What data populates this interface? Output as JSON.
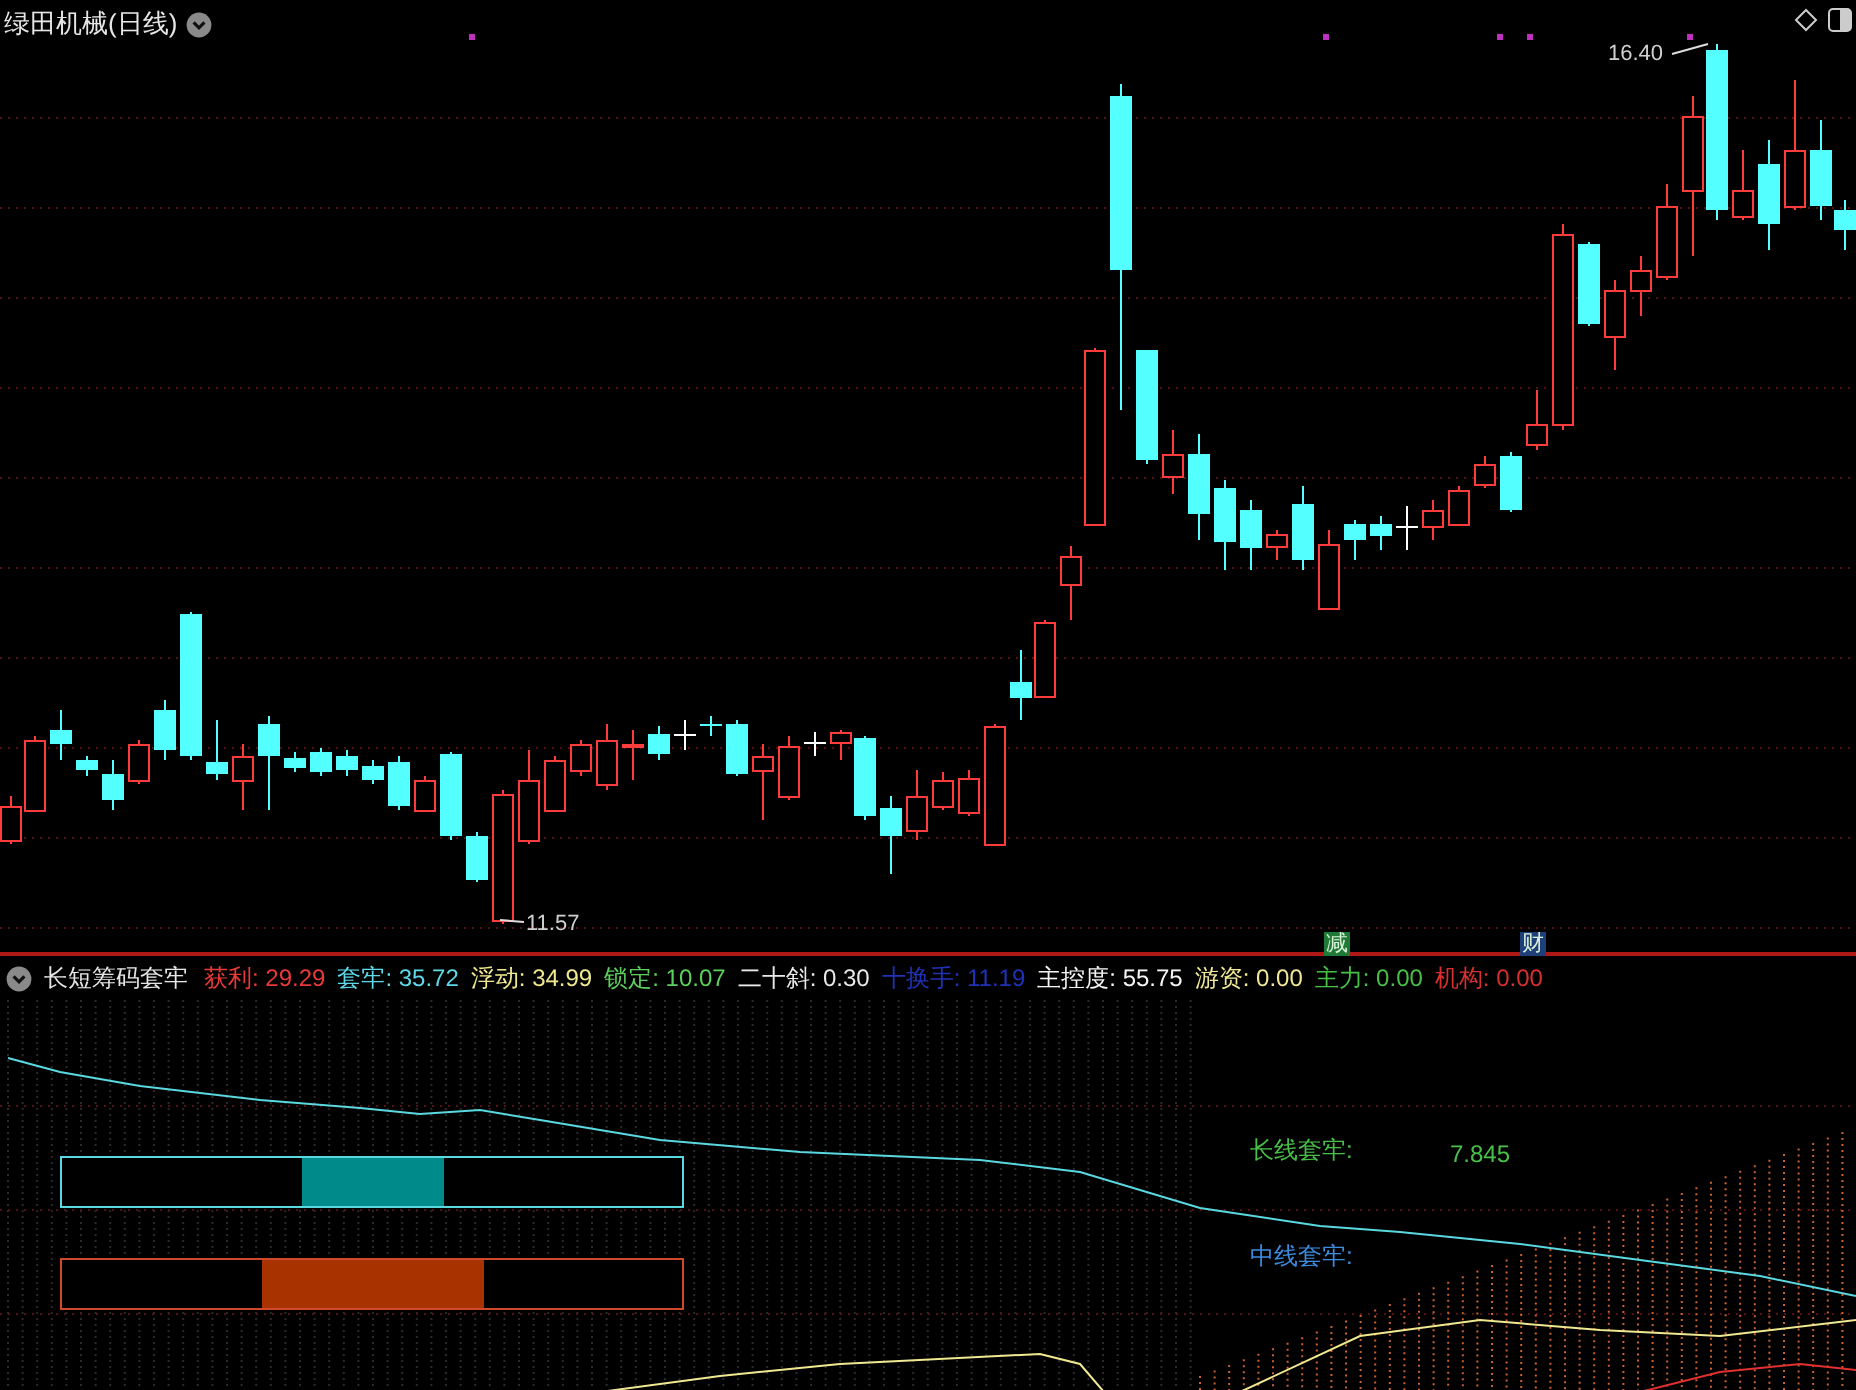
{
  "window": {
    "title": "绿田机械(日线)"
  },
  "price_chart": {
    "high_label": "16.40",
    "low_label": "11.57",
    "event_markers": [
      {
        "text": "减",
        "color": "#1f7a35"
      },
      {
        "text": "财",
        "color": "#1e3f7a"
      }
    ]
  },
  "indicator": {
    "title": "长短筹码套牢",
    "readings": [
      {
        "label": "获利:",
        "value": "29.29",
        "color": "#e83a3a"
      },
      {
        "label": "套牢:",
        "value": "35.72",
        "color": "#5fd8e8"
      },
      {
        "label": "浮动:",
        "value": "34.99",
        "color": "#f0e890"
      },
      {
        "label": "锁定:",
        "value": "10.07",
        "color": "#5cd05c"
      },
      {
        "label": "二十斜:",
        "value": "0.30",
        "color": "#e8e8e8"
      },
      {
        "label": "十换手:",
        "value": "11.19",
        "color": "#2032b8"
      },
      {
        "label": "主控度:",
        "value": "55.75",
        "color": "#f4f4f4"
      },
      {
        "label": "游资:",
        "value": "0.00",
        "color": "#f0e898"
      },
      {
        "label": "主力:",
        "value": "0.00",
        "color": "#48c048"
      },
      {
        "label": "机构:",
        "value": "0.00",
        "color": "#d83030"
      }
    ],
    "gauge_labels": [
      {
        "label": "长线套牢:",
        "value": "7.845",
        "color": "#48c048"
      },
      {
        "label": "中线套牢:",
        "color": "#3c8ce0"
      }
    ]
  }
}
